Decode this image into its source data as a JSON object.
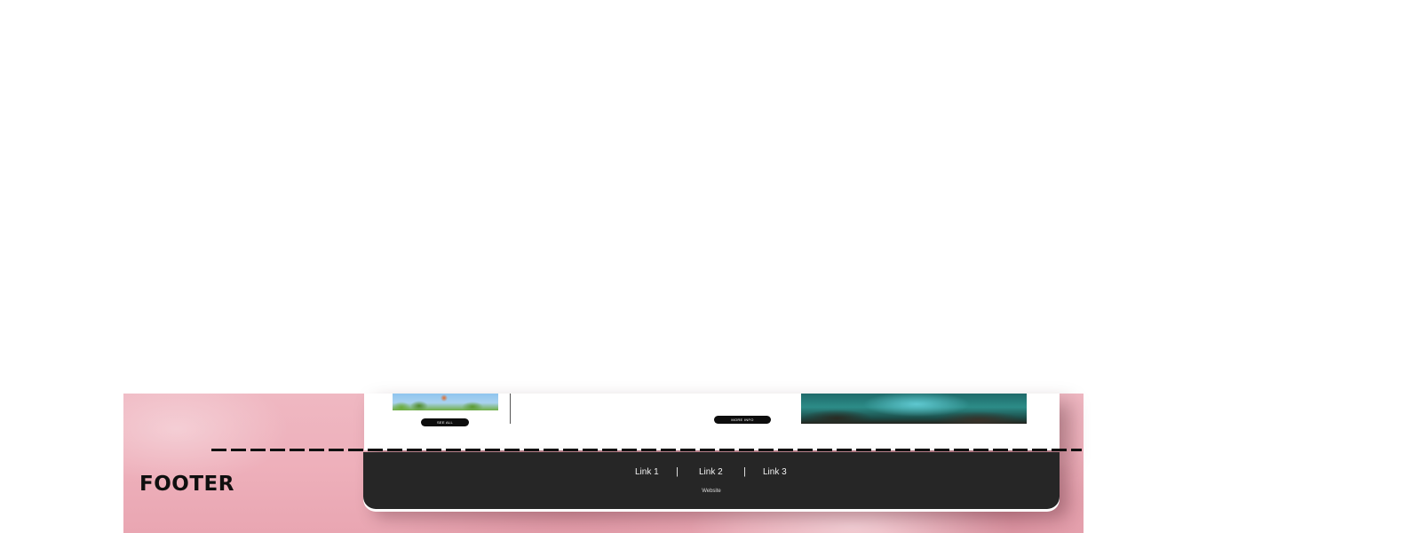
{
  "footer_section": {
    "heading": "FOOTER"
  },
  "card": {
    "see_all_label": "SEE ALL",
    "more_info_label": "MORE INFO"
  },
  "footer_bar": {
    "links": [
      {
        "label": "Link 1"
      },
      {
        "label": "Link 2"
      },
      {
        "label": "Link 3"
      }
    ],
    "separator": "|",
    "caption": "Website"
  },
  "colors": {
    "footer_bar_bg": "#262626",
    "pink_background": "#eeb0bb",
    "button_bg": "#0d0d0d"
  }
}
